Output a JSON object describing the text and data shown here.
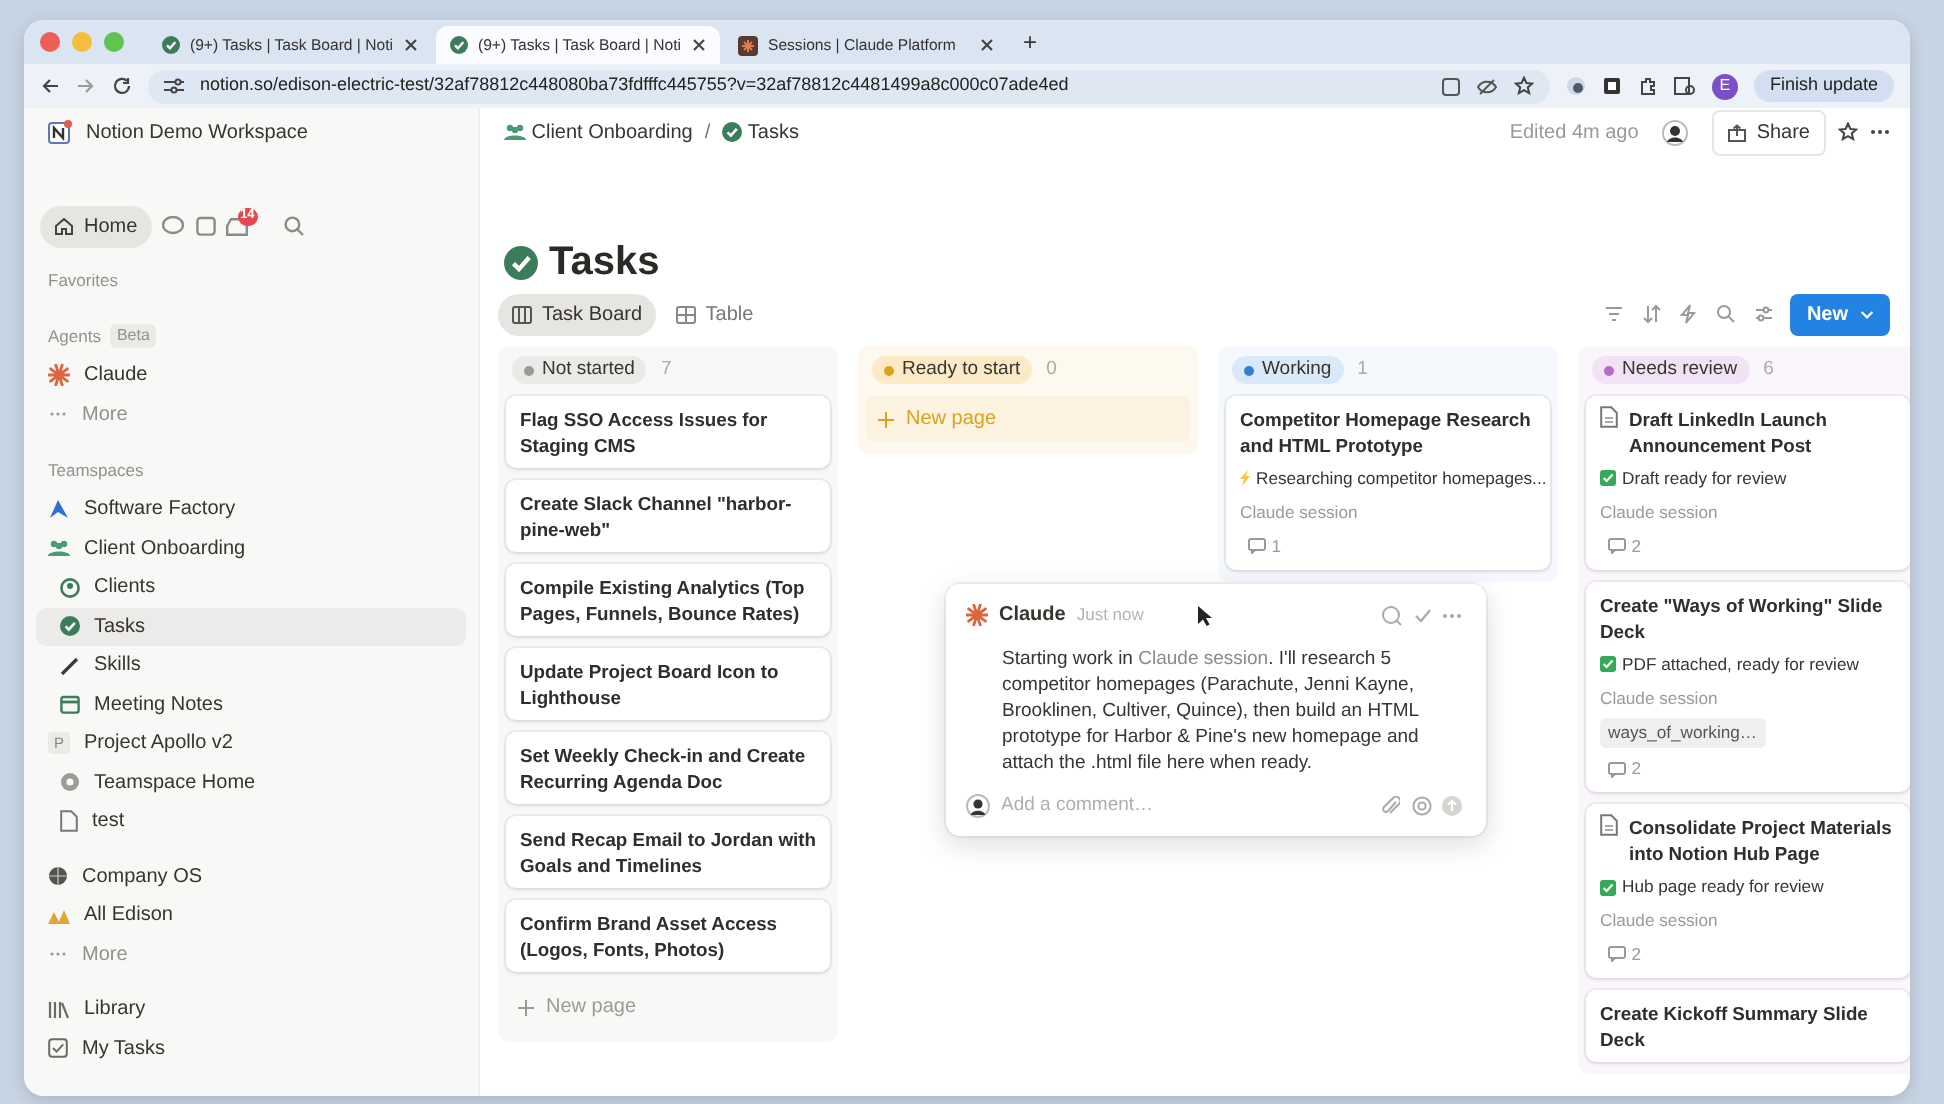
{
  "browser": {
    "tabs": [
      {
        "title": "(9+) Tasks | Task Board | Noti",
        "selected": false,
        "kind": "notion"
      },
      {
        "title": "(9+) Tasks | Task Board | Noti",
        "selected": true,
        "kind": "notion"
      },
      {
        "title": "Sessions | Claude Platform",
        "selected": false,
        "kind": "claude"
      }
    ],
    "new_tab": "+",
    "url": "notion.so/edison-electric-test/32af78812c448080ba73fdfffc445755?v=32af78812c4481499a8c000c07ade4ed",
    "profile": "E",
    "finish_update": "Finish update"
  },
  "workspace": {
    "name": "Notion Demo Workspace"
  },
  "breadcrumbs": [
    {
      "label": "Client Onboarding",
      "kind": "teamspace"
    },
    {
      "label": "Tasks",
      "kind": "database"
    }
  ],
  "breadcrumb_separator": "/",
  "header": {
    "edited": "Edited 4m ago",
    "share": "Share"
  },
  "sidebar": {
    "home": {
      "label": "Home",
      "selected": true
    },
    "inbox_badge": "14",
    "sections": [
      {
        "heading": "Favorites"
      },
      {
        "heading": "Agents",
        "badge": "Beta",
        "items": [
          {
            "label": "Claude",
            "selected": false
          },
          {
            "label": "More",
            "selected": false
          }
        ]
      },
      {
        "heading": "Teamspaces",
        "items": [
          {
            "label": "Software Factory",
            "selected": false
          },
          {
            "label": "Client Onboarding",
            "selected": false,
            "children": [
              {
                "label": "Clients",
                "selected": false
              },
              {
                "label": "Tasks",
                "selected": true
              },
              {
                "label": "Skills",
                "selected": false
              },
              {
                "label": "Meeting Notes",
                "selected": false
              }
            ]
          },
          {
            "label": "Project Apollo v2",
            "letter": "P",
            "selected": false,
            "children": [
              {
                "label": "Teamspace Home",
                "selected": false
              },
              {
                "label": "test",
                "selected": false
              }
            ]
          }
        ]
      },
      {
        "items": [
          {
            "label": "Company OS",
            "selected": false
          },
          {
            "label": "All Edison",
            "selected": false
          },
          {
            "label": "More",
            "selected": false
          }
        ]
      },
      {
        "items": [
          {
            "label": "Library",
            "selected": false
          },
          {
            "label": "My Tasks",
            "selected": false
          }
        ]
      }
    ]
  },
  "page": {
    "title": "Tasks",
    "views": [
      {
        "label": "Task Board",
        "selected": true,
        "kind": "board"
      },
      {
        "label": "Table",
        "selected": false,
        "kind": "table"
      }
    ],
    "new_button": "New"
  },
  "columns": [
    {
      "label": "Not started",
      "count": "7",
      "color": "#9b9a97",
      "new_page": "New page",
      "cards": [
        {
          "title": "Flag SSO Access Issues for Staging CMS"
        },
        {
          "title": "Create Slack Channel \"harbor-pine-web\""
        },
        {
          "title": "Compile Existing Analytics (Top Pages, Funnels, Bounce Rates)"
        },
        {
          "title": "Update Project Board Icon to Lighthouse"
        },
        {
          "title": "Set Weekly Check-in and Create Recurring Agenda Doc"
        },
        {
          "title": "Send Recap Email to Jordan with Goals and Timelines"
        },
        {
          "title": "Confirm Brand Asset Access (Logos, Fonts, Photos)"
        }
      ]
    },
    {
      "label": "Ready to start",
      "count": "0",
      "color": "#d9a321",
      "new_page": "New page"
    },
    {
      "label": "Working",
      "count": "1",
      "color": "#2f80d0",
      "cards": [
        {
          "title": "Competitor Homepage Research and HTML Prototype",
          "progress": "Researching competitor homepages...",
          "session": "Claude session",
          "comments": "1"
        }
      ]
    },
    {
      "label": "Needs review",
      "count": "6",
      "color": "#b46ccc",
      "cards": [
        {
          "title": "Draft LinkedIn Launch Announcement Post",
          "doc": true,
          "status": "Draft ready for review",
          "session": "Claude session",
          "comments": "2"
        },
        {
          "title": "Create \"Ways of Working\" Slide Deck",
          "status": "PDF attached, ready for review",
          "session": "Claude session",
          "file": "ways_of_working…",
          "comments": "2"
        },
        {
          "title": "Consolidate Project Materials into Notion Hub Page",
          "doc": true,
          "status": "Hub page ready for review",
          "session": "Claude session",
          "comments": "2"
        },
        {
          "title": "Create Kickoff Summary Slide Deck"
        }
      ]
    }
  ],
  "comment": {
    "author": "Claude",
    "time": "Just now",
    "body_before": "Starting work in ",
    "link": "Claude session",
    "body_after": ". I'll research 5 competitor homepages (Parachute, Jenni Kayne, Brooklinen, Cultiver, Quince), then build an HTML prototype for Harbor & Pine's new homepage and attach the .html file here when ready.",
    "placeholder": "Add a comment…"
  }
}
